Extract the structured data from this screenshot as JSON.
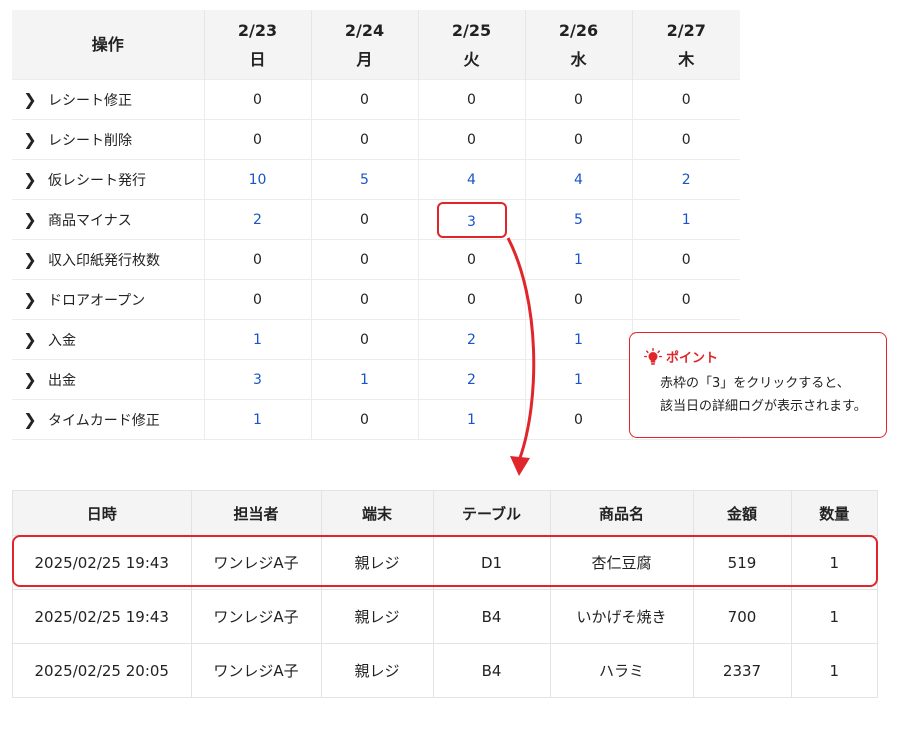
{
  "ops_table": {
    "header_label": "操作",
    "dates": [
      {
        "date": "2/23",
        "dow": "日"
      },
      {
        "date": "2/24",
        "dow": "月"
      },
      {
        "date": "2/25",
        "dow": "火"
      },
      {
        "date": "2/26",
        "dow": "水"
      },
      {
        "date": "2/27",
        "dow": "木"
      }
    ],
    "rows": [
      {
        "label": "レシート修正",
        "values": [
          "0",
          "0",
          "0",
          "0",
          "0"
        ],
        "links": [
          false,
          false,
          false,
          false,
          false
        ]
      },
      {
        "label": "レシート削除",
        "values": [
          "0",
          "0",
          "0",
          "0",
          "0"
        ],
        "links": [
          false,
          false,
          false,
          false,
          false
        ]
      },
      {
        "label": "仮レシート発行",
        "values": [
          "10",
          "5",
          "4",
          "4",
          "2"
        ],
        "links": [
          true,
          true,
          true,
          true,
          true
        ]
      },
      {
        "label": "商品マイナス",
        "values": [
          "2",
          "0",
          "3",
          "5",
          "1"
        ],
        "links": [
          true,
          false,
          true,
          true,
          true
        ]
      },
      {
        "label": "収入印紙発行枚数",
        "values": [
          "0",
          "0",
          "0",
          "1",
          "0"
        ],
        "links": [
          false,
          false,
          false,
          true,
          false
        ]
      },
      {
        "label": "ドロアオープン",
        "values": [
          "0",
          "0",
          "0",
          "0",
          "0"
        ],
        "links": [
          false,
          false,
          false,
          false,
          false
        ]
      },
      {
        "label": "入金",
        "values": [
          "1",
          "0",
          "2",
          "1",
          ""
        ],
        "links": [
          true,
          false,
          true,
          true,
          false
        ]
      },
      {
        "label": "出金",
        "values": [
          "3",
          "1",
          "2",
          "1",
          ""
        ],
        "links": [
          true,
          true,
          true,
          true,
          false
        ]
      },
      {
        "label": "タイムカード修正",
        "values": [
          "1",
          "0",
          "1",
          "0",
          ""
        ],
        "links": [
          true,
          false,
          true,
          false,
          false
        ]
      }
    ]
  },
  "callout": {
    "title": "ポイント",
    "line1": "赤枠の「3」をクリックすると、",
    "line2": "該当日の詳細ログが表示されます。",
    "accent_color": "#e0262b"
  },
  "log_table": {
    "headers": [
      "日時",
      "担当者",
      "端末",
      "テーブル",
      "商品名",
      "金額",
      "数量"
    ],
    "rows": [
      [
        "2025/02/25 19:43",
        "ワンレジA子",
        "親レジ",
        "D1",
        "杏仁豆腐",
        "519",
        "1"
      ],
      [
        "2025/02/25 19:43",
        "ワンレジA子",
        "親レジ",
        "B4",
        "いかげそ焼き",
        "700",
        "1"
      ],
      [
        "2025/02/25 20:05",
        "ワンレジA子",
        "親レジ",
        "B4",
        "ハラミ",
        "2337",
        "1"
      ]
    ]
  },
  "colors": {
    "link": "#1a55c8",
    "highlight": "#e0262b",
    "header_bg": "#f4f4f4"
  }
}
